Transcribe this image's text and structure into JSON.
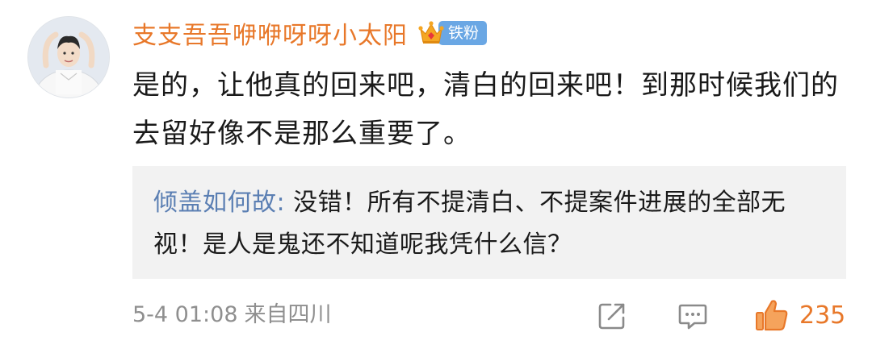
{
  "comment": {
    "username": "支支吾吾咿咿呀呀小太阳",
    "fan_badge": "铁粉",
    "text": "是的，让他真的回来吧，清白的回来吧！到那时候我们的去留好像不是那么重要了。"
  },
  "reply": {
    "author": "倾盖如何故",
    "separator": ": ",
    "text": "没错！所有不提清白、不提案件进展的全部无视！是人是鬼还不知道呢我凭什么信？"
  },
  "footer": {
    "timestamp": "5-4 01:08",
    "source": "来自四川",
    "like_count": "235"
  },
  "icons": {
    "avatar": "avatar-image",
    "crown": "crown-icon",
    "share": "share-icon",
    "comment": "comment-icon",
    "like": "thumbs-up-icon"
  },
  "colors": {
    "username": "#e8782a",
    "badge": "#6aa7e4",
    "reply_author": "#5b7fb3",
    "meta": "#8f8f8f",
    "like": "#e8782a",
    "reply_bg": "#f2f2f2"
  }
}
